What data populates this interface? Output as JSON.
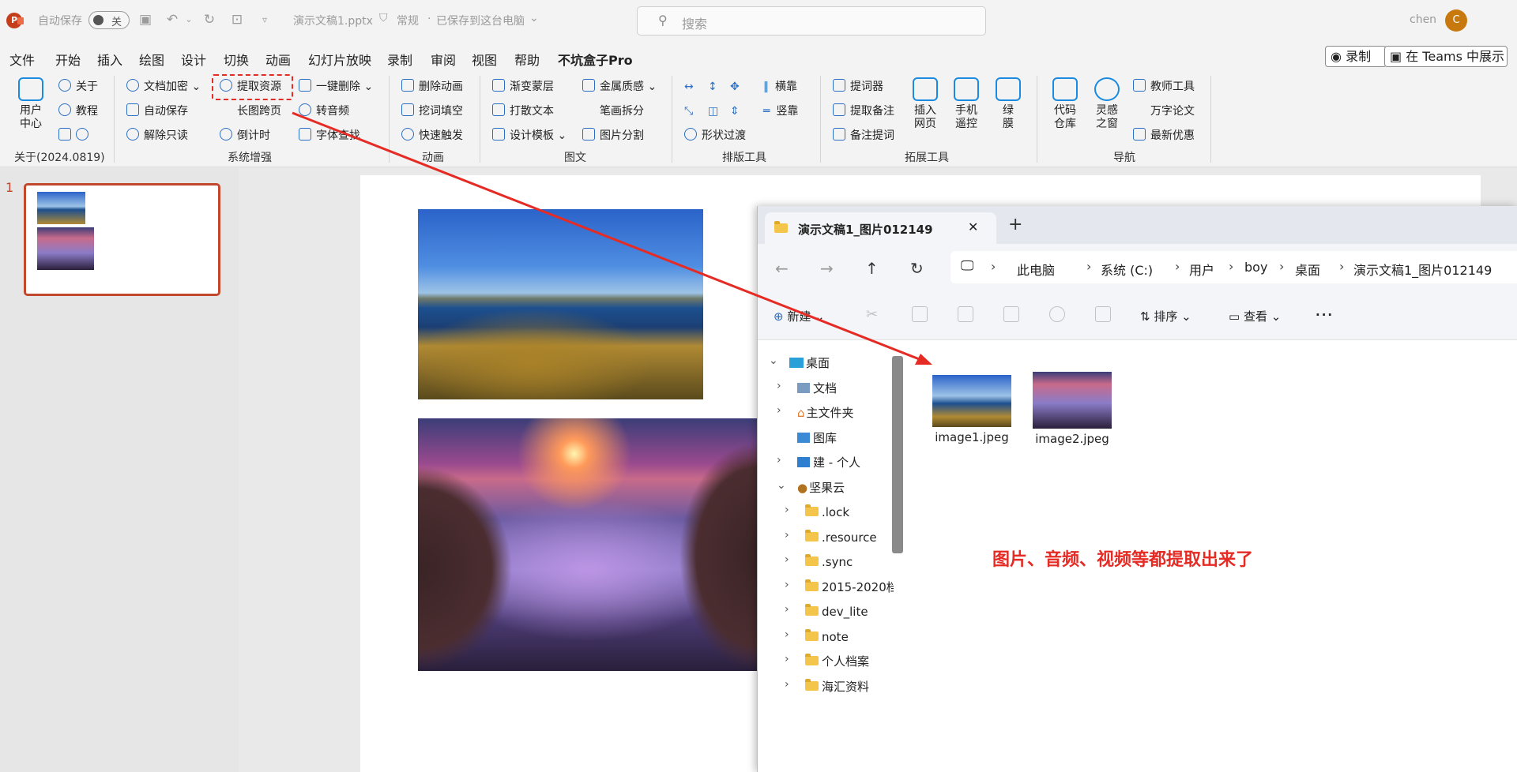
{
  "titlebar": {
    "app_logo": "P",
    "autosave_label": "自动保存",
    "autosave_state": "关",
    "doc_name": "演示文稿1.pptx",
    "sensitivity": "常规",
    "save_status": "已保存到这台电脑",
    "search_placeholder": "搜索",
    "user_name": "chen",
    "avatar_letter": "C"
  },
  "menu": {
    "items": [
      "文件",
      "开始",
      "插入",
      "绘图",
      "设计",
      "切换",
      "动画",
      "幻灯片放映",
      "录制",
      "审阅",
      "视图",
      "帮助",
      "不坑盒子Pro"
    ],
    "record_label": "录制",
    "teams_label": "在 Teams 中展示"
  },
  "ribbon": {
    "user_center": "用户\n中心",
    "about": "关于",
    "tutorial": "教程",
    "version": "关于(2024.0819)",
    "g1": {
      "label": "系统增强",
      "doc_encrypt": "文档加密",
      "auto_save": "自动保存",
      "unlock_readonly": "解除只读",
      "extract": "提取资源",
      "long_img": "长图跨页",
      "countdown": "倒计时",
      "one_click_delete": "一键删除",
      "to_audio": "转音频",
      "font_check": "字体查找"
    },
    "g2": {
      "label": "动画",
      "delete_anim": "删除动画",
      "cloze": "挖词填空",
      "quick_trigger": "快速触发"
    },
    "g3": {
      "label": "图文",
      "gradient": "渐变蒙层",
      "scatter_text": "打散文本",
      "design_template": "设计模板",
      "metal": "金属质感",
      "stroke_split": "笔画拆分",
      "img_split": "图片分割"
    },
    "g4": {
      "label": "排版工具",
      "h_align": "横靠",
      "v_align": "竖靠",
      "shape_transition": "形状过渡"
    },
    "g5": {
      "label": "拓展工具",
      "prompter": "提词器",
      "extract_notes": "提取备注",
      "note_prompt": "备注提词",
      "insert_web": "插入\n网页",
      "remote": "手机\n遥控",
      "green_screen": "绿\n膜"
    },
    "g6": {
      "label": "导航",
      "code_repo": "代码\n仓库",
      "inspiration": "灵感\n之窗",
      "teacher_tools": "教师工具",
      "essay": "万字论文",
      "deals": "最新优惠"
    }
  },
  "slides": {
    "number": "1"
  },
  "explorer": {
    "tab_title": "演示文稿1_图片012149",
    "breadcrumbs": [
      "此电脑",
      "系统 (C:)",
      "用户",
      "boy",
      "桌面",
      "演示文稿1_图片012149"
    ],
    "new_label": "新建",
    "sort_label": "排序",
    "view_label": "查看",
    "nav_items": [
      "桌面",
      "文档",
      "主文件夹",
      "图库",
      "建 - 个人",
      "坚果云",
      ".lock",
      ".resource",
      ".sync",
      "2015-2020档",
      "dev_lite",
      "note",
      "个人档案",
      "海汇资料"
    ],
    "files": [
      "image1.jpeg",
      "image2.jpeg"
    ]
  },
  "annotation": "图片、音频、视频等都提取出来了",
  "colors": {
    "accent": "#c43e1c",
    "annotation": "#e52b24",
    "ribbon_icon": "#2b6fc4"
  }
}
